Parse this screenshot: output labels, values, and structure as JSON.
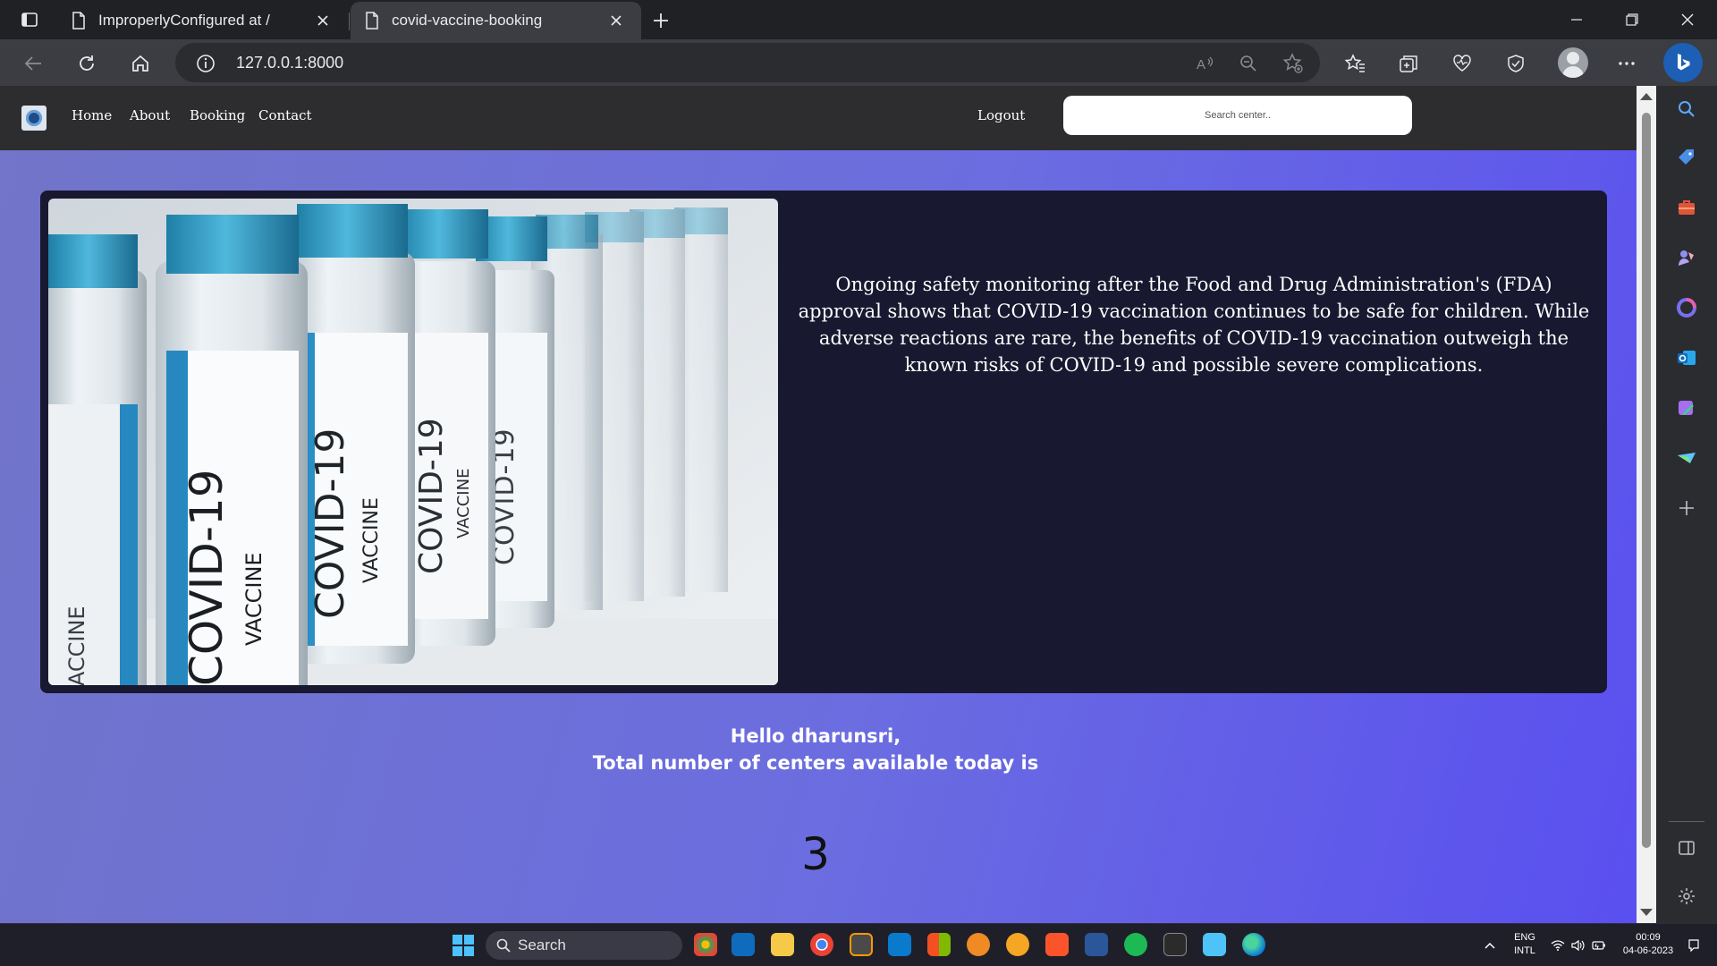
{
  "browser": {
    "tabs": [
      {
        "title": "ImproperlyConfigured at /",
        "active": false
      },
      {
        "title": "covid-vaccine-booking",
        "active": true
      }
    ],
    "address": "127.0.0.1:8000"
  },
  "site": {
    "nav": {
      "items": [
        {
          "label": "Home"
        },
        {
          "label": "About"
        },
        {
          "label": "Booking"
        },
        {
          "label": "Contact"
        }
      ],
      "logout": "Logout",
      "search_placeholder": "Search center.."
    },
    "hero": {
      "image_texts": [
        "COVID-19",
        "VACCINE"
      ],
      "text": "Ongoing safety monitoring after the Food and Drug Administration's (FDA) approval shows that COVID-19 vaccination continues to be safe for children. While adverse reactions are rare, the benefits of COVID-19 vaccination outweigh the known risks of COVID-19 and possible severe complications."
    },
    "greeting": {
      "line1": "Hello dharunsri,",
      "line2": "Total number of centers available today is"
    },
    "center_count": "3"
  },
  "taskbar": {
    "search_label": "Search",
    "language_line1": "ENG",
    "language_line2": "INTL",
    "time": "00:09",
    "date": "04-06-2023"
  },
  "colors": {
    "page_gradient_start": "#7275c8",
    "page_gradient_end": "#5a4ff0",
    "nav_bg": "#2d2d2f",
    "hero_bg": "#181830",
    "accent": "#4cc2ff"
  }
}
